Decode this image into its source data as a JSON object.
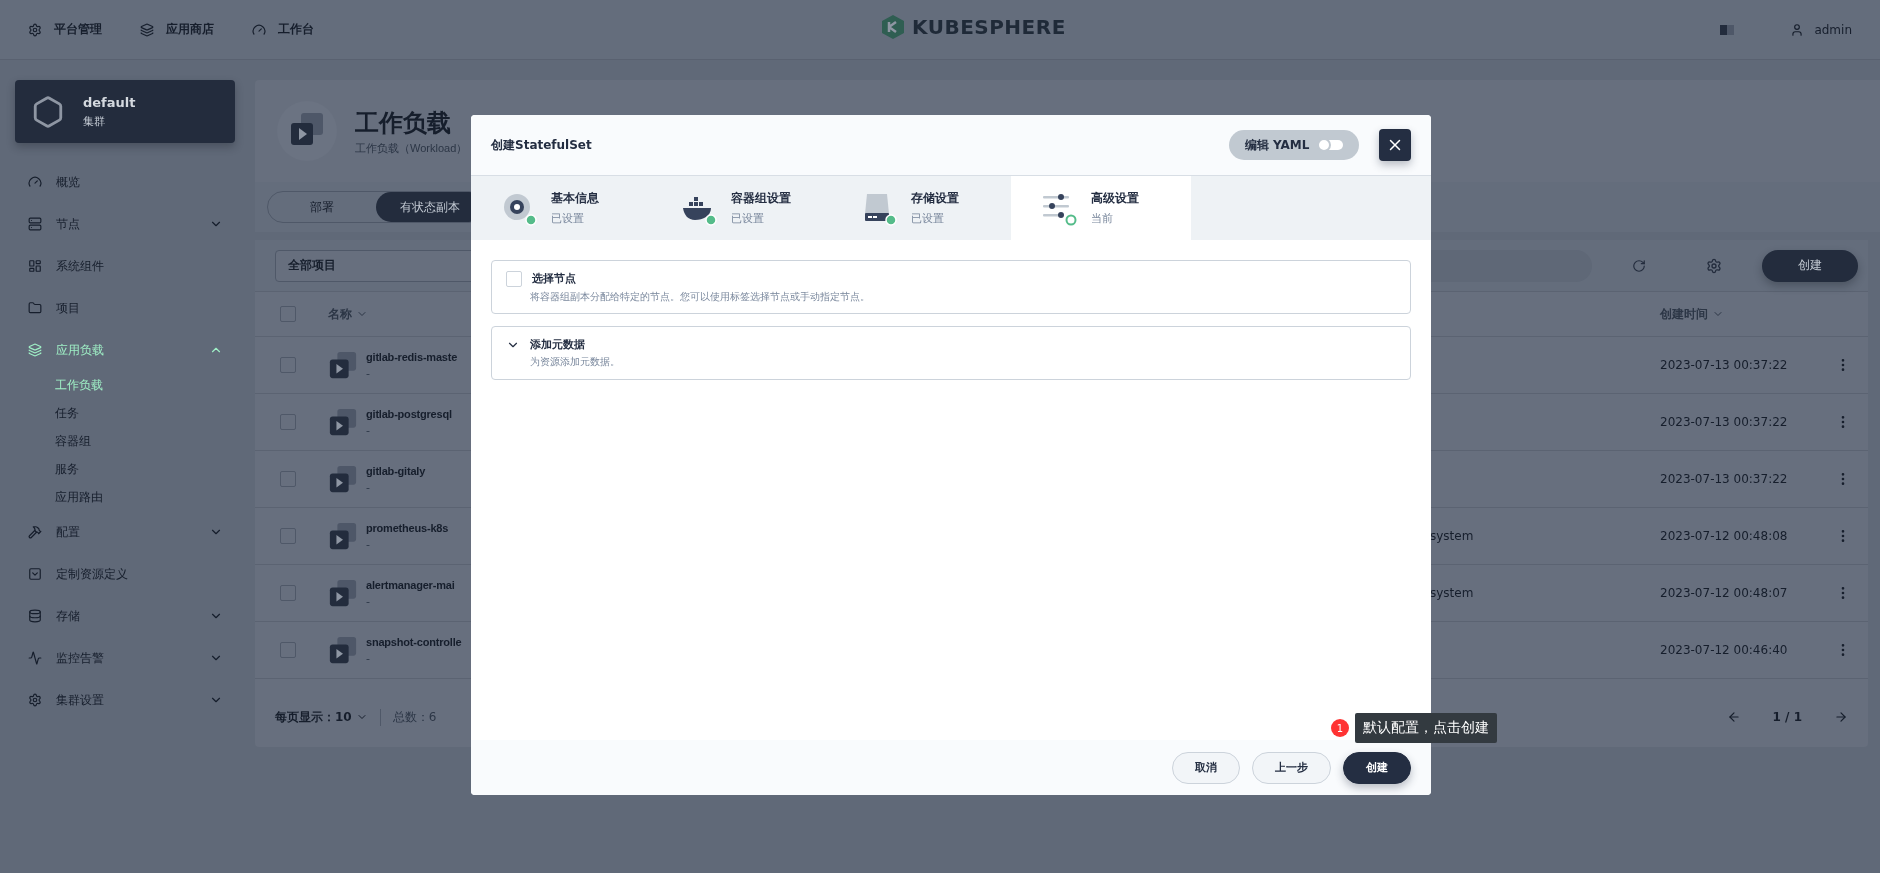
{
  "top_nav": [
    {
      "label": "平台管理"
    },
    {
      "label": "应用商店"
    },
    {
      "label": "工作台"
    }
  ],
  "logo": {
    "text": "KUBESPHERE"
  },
  "user": {
    "name": "admin"
  },
  "cluster": {
    "name": "default",
    "type": "集群"
  },
  "sidebar": {
    "items": [
      {
        "label": "概览",
        "kind": "link"
      },
      {
        "label": "节点",
        "kind": "group",
        "expanded": false
      },
      {
        "label": "系统组件",
        "kind": "link"
      },
      {
        "label": "项目",
        "kind": "link"
      },
      {
        "label": "应用负载",
        "kind": "group",
        "expanded": true,
        "children": [
          {
            "label": "工作负载",
            "selected": true
          },
          {
            "label": "任务",
            "selected": false
          },
          {
            "label": "容器组",
            "selected": false
          },
          {
            "label": "服务",
            "selected": false
          },
          {
            "label": "应用路由",
            "selected": false
          }
        ]
      },
      {
        "label": "配置",
        "kind": "group",
        "expanded": false
      },
      {
        "label": "定制资源定义",
        "kind": "link"
      },
      {
        "label": "存储",
        "kind": "group",
        "expanded": false
      },
      {
        "label": "监控告警",
        "kind": "group",
        "expanded": false
      },
      {
        "label": "集群设置",
        "kind": "group",
        "expanded": false
      }
    ]
  },
  "page_header": {
    "title": "工作负载",
    "subtitle": "工作负载（Workload）"
  },
  "tabs": [
    {
      "label": "部署",
      "selected": false
    },
    {
      "label": "有状态副本",
      "selected": true
    }
  ],
  "toolbar": {
    "project_select": "全部项目",
    "create_button": "创建"
  },
  "table": {
    "select_all": {
      "checked": false
    },
    "columns": [
      {
        "label": "名称"
      },
      {
        "label": "创建时间"
      }
    ],
    "rows": [
      {
        "name": "gitlab-redis-maste",
        "description": "-",
        "created": "2023-07-13 00:37:22",
        "checked": false
      },
      {
        "name": "gitlab-postgresql",
        "description": "-",
        "created": "2023-07-13 00:37:22",
        "checked": false
      },
      {
        "name": "gitlab-gitaly",
        "description": "-",
        "created": "2023-07-13 00:37:22",
        "checked": false
      },
      {
        "name": "prometheus-k8s",
        "description": "-",
        "namespace": "system",
        "created": "2023-07-12 00:48:08",
        "checked": false
      },
      {
        "name": "alertmanager-mai",
        "description": "-",
        "namespace": "system",
        "created": "2023-07-12 00:48:07",
        "checked": false
      },
      {
        "name": "snapshot-controlle",
        "description": "-",
        "created": "2023-07-12 00:46:40",
        "checked": false
      }
    ]
  },
  "pagination": {
    "per_page_label": "每页显示：",
    "per_page": "10",
    "total": "总数：6",
    "page": "1 / 1"
  },
  "modal": {
    "title": "创建StatefulSet",
    "yaml_toggle": {
      "label": "编辑 YAML",
      "on": false
    },
    "steps": [
      {
        "title": "基本信息",
        "status": "已设置",
        "done": true,
        "selected": false
      },
      {
        "title": "容器组设置",
        "status": "已设置",
        "done": true,
        "selected": false
      },
      {
        "title": "存储设置",
        "status": "已设置",
        "done": true,
        "selected": false
      },
      {
        "title": "高级设置",
        "status": "当前",
        "done": false,
        "selected": true
      }
    ],
    "sections": [
      {
        "kind": "checkbox",
        "title": "选择节点",
        "description": "将容器组副本分配给特定的节点。您可以使用标签选择节点或手动指定节点。",
        "checked": false
      },
      {
        "kind": "collapsible",
        "title": "添加元数据",
        "description": "为资源添加元数据。",
        "expanded": false
      }
    ],
    "buttons": {
      "cancel": "取消",
      "previous": "上一步",
      "create": "创建"
    }
  },
  "tooltip": {
    "badge": "1",
    "text": "默认配置，点击创建"
  }
}
